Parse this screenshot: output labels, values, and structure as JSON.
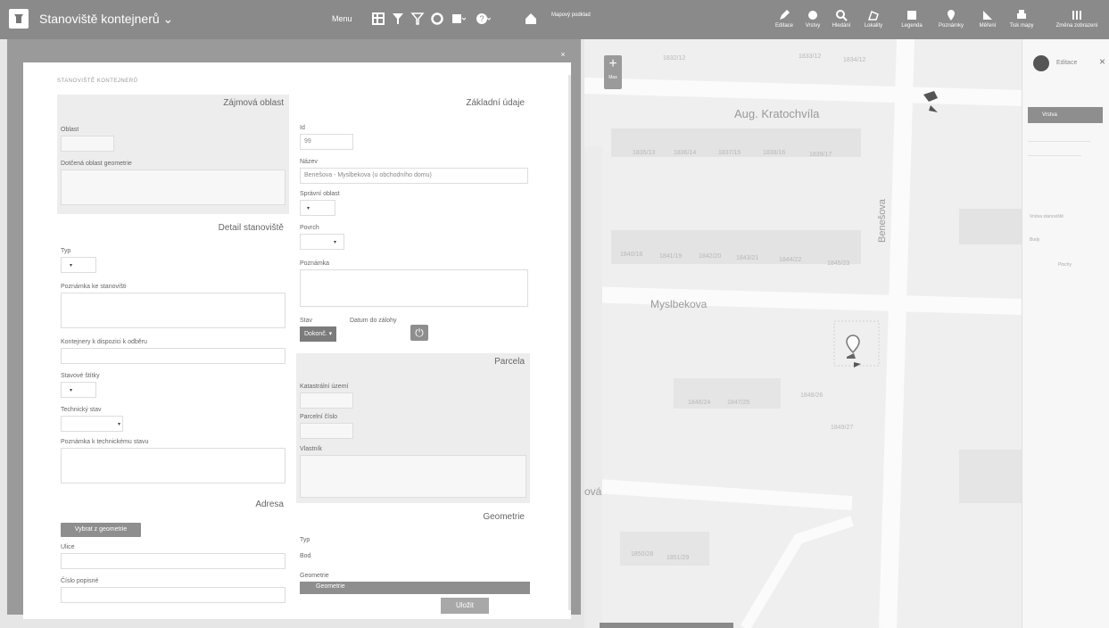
{
  "header": {
    "app_title": "Stanoviště kontejnerů",
    "menu_label": "Menu",
    "background_layer_label": "Mapový podklad"
  },
  "tools": [
    {
      "label": "Editace"
    },
    {
      "label": "Vrstvy"
    },
    {
      "label": "Hledání"
    },
    {
      "label": "Lokality"
    },
    {
      "label": "Legenda"
    },
    {
      "label": "Poznámky"
    },
    {
      "label": "Měření"
    },
    {
      "label": "Tisk mapy"
    },
    {
      "label": "Změna zobrazení"
    }
  ],
  "dialog": {
    "close_label": "×",
    "breadcrumb": "STANOVIŠTĚ KONTEJNERŮ",
    "zajmova_oblast": {
      "title": "Zájmová oblast",
      "oblast_label": "Oblast",
      "geometrie_label": "Dotčená oblast geometrie"
    },
    "detail": {
      "title": "Detail stanoviště",
      "typ_label": "Typ",
      "poznamka_label": "Poznámka ke stanovišti",
      "kontejnery_label": "Kontejnery k dispozici k odběru",
      "stav_stitky_label": "Stavové štítky",
      "technicky_stav_label": "Technický stav",
      "poznamka_tech_label": "Poznámka k technickému stavu"
    },
    "adresa": {
      "title": "Adresa",
      "vybrat_button": "Vybrat z geometrie",
      "ulice_label": "Ulice",
      "cislo_label": "Číslo popisné"
    },
    "zakladni": {
      "title": "Základní údaje",
      "id_label": "Id",
      "id_value": "99",
      "nazev_label": "Název",
      "nazev_value": "Benešova - Myslbekova (u obchodního domu)",
      "spravni_label": "Správní oblast",
      "povrch_label": "Povrch",
      "poznamka_label": "Poznámka",
      "stav_label": "Stav",
      "datum_label": "Datum do zálohy",
      "stav_value": "Dokonč."
    },
    "parcela": {
      "title": "Parcela",
      "katastralni_label": "Katastrální území",
      "parcelni_label": "Parcelní číslo",
      "vlastnik_label": "Vlastník"
    },
    "geometrie": {
      "title": "Geometrie",
      "typ_label": "Typ",
      "typ_value": "Bod",
      "geom_label": "Geometrie",
      "geom_value": "Geometrie"
    },
    "save_button": "Uložit"
  },
  "map": {
    "zoom_plus": "+",
    "zoom_sub": "Max",
    "streets": {
      "aug": "Aug. Kratochvíla",
      "mys": "Myslbekova",
      "ben": "Benešova",
      "ova": "ová"
    },
    "house_numbers": [
      "1832/12",
      "1833/12",
      "1834/12",
      "1835/13",
      "1836/14",
      "1837/15",
      "1838/16",
      "1839/17",
      "1840/18",
      "1841/19",
      "1842/20",
      "1843/21",
      "1844/22",
      "1845/23",
      "1846/24",
      "1847/25",
      "1848/26",
      "1849/27",
      "1850/28",
      "1851/29"
    ]
  },
  "right_panel": {
    "edit_label": "Editace",
    "close": "×",
    "button_label": "Vrstva",
    "texts": [
      "Vrstva stanoviště",
      "Body",
      "Plochy"
    ]
  }
}
